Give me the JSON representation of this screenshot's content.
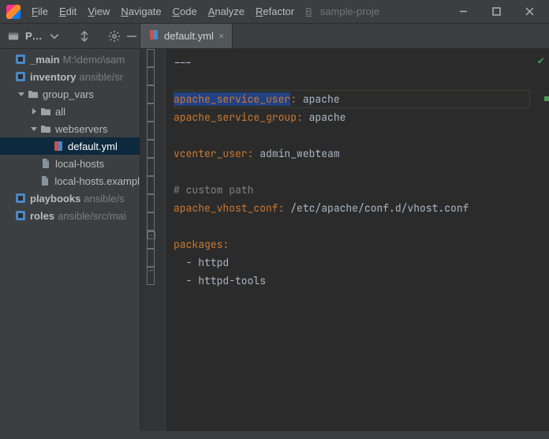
{
  "project_name": "sample-proje",
  "menu": [
    "File",
    "Edit",
    "View",
    "Navigate",
    "Code",
    "Analyze",
    "Refactor",
    "B"
  ],
  "project_selector_label": "P…",
  "tab": {
    "filename": "default.yml"
  },
  "tree": {
    "items": [
      {
        "depth": 0,
        "expand": "none",
        "icon": "module",
        "label": "_main",
        "hint": "M:\\demo\\sam",
        "bold": true
      },
      {
        "depth": 0,
        "expand": "none",
        "icon": "module",
        "label": "inventory",
        "hint": "ansible/sr",
        "bold": true
      },
      {
        "depth": 1,
        "expand": "open",
        "icon": "folder",
        "label": "group_vars"
      },
      {
        "depth": 2,
        "expand": "closed",
        "icon": "folder",
        "label": "all"
      },
      {
        "depth": 2,
        "expand": "open",
        "icon": "folder",
        "label": "webservers"
      },
      {
        "depth": 3,
        "expand": "none",
        "icon": "yaml",
        "label": "default.yml",
        "selected": true
      },
      {
        "depth": 2,
        "expand": "none",
        "icon": "file",
        "label": "local-hosts"
      },
      {
        "depth": 2,
        "expand": "none",
        "icon": "file",
        "label": "local-hosts.exampl"
      },
      {
        "depth": 0,
        "expand": "none",
        "icon": "module",
        "label": "playbooks",
        "hint": "ansible/s",
        "bold": true
      },
      {
        "depth": 0,
        "expand": "none",
        "icon": "module",
        "label": "roles",
        "hint": "ansible/src/mai",
        "bold": true
      }
    ]
  },
  "editor": {
    "caret_line_index": 2,
    "lines": [
      {
        "tokens": [
          {
            "t": "---",
            "c": "doc"
          }
        ]
      },
      {
        "tokens": []
      },
      {
        "tokens": [
          {
            "t": "apache_service_user",
            "c": "key",
            "sel": true
          },
          {
            "t": ":",
            "c": "key"
          },
          {
            "t": " apache",
            "c": "str"
          }
        ]
      },
      {
        "tokens": [
          {
            "t": "apache_service_group",
            "c": "key"
          },
          {
            "t": ":",
            "c": "key"
          },
          {
            "t": " apache",
            "c": "str"
          }
        ]
      },
      {
        "tokens": []
      },
      {
        "tokens": [
          {
            "t": "vcenter_user",
            "c": "key"
          },
          {
            "t": ":",
            "c": "key"
          },
          {
            "t": " admin_webteam",
            "c": "str"
          }
        ]
      },
      {
        "tokens": []
      },
      {
        "tokens": [
          {
            "t": "# custom path",
            "c": "cmt"
          }
        ]
      },
      {
        "tokens": [
          {
            "t": "apache_vhost_conf",
            "c": "key"
          },
          {
            "t": ":",
            "c": "key"
          },
          {
            "t": " /etc/apache/conf.d/vhost.conf",
            "c": "str"
          }
        ]
      },
      {
        "tokens": []
      },
      {
        "tokens": [
          {
            "t": "packages",
            "c": "key"
          },
          {
            "t": ":",
            "c": "key"
          }
        ],
        "fold": "open"
      },
      {
        "tokens": [
          {
            "t": "  - ",
            "c": "str"
          },
          {
            "t": "httpd",
            "c": "str"
          }
        ]
      },
      {
        "tokens": [
          {
            "t": "  - ",
            "c": "str"
          },
          {
            "t": "httpd-tools",
            "c": "str"
          }
        ],
        "fold": "end"
      }
    ]
  },
  "colors": {
    "accent": "#cc7832",
    "selection": "#214283",
    "ok": "#499c54"
  },
  "window_controls": {
    "minimize": "–",
    "maximize": "▢",
    "close": "×"
  }
}
